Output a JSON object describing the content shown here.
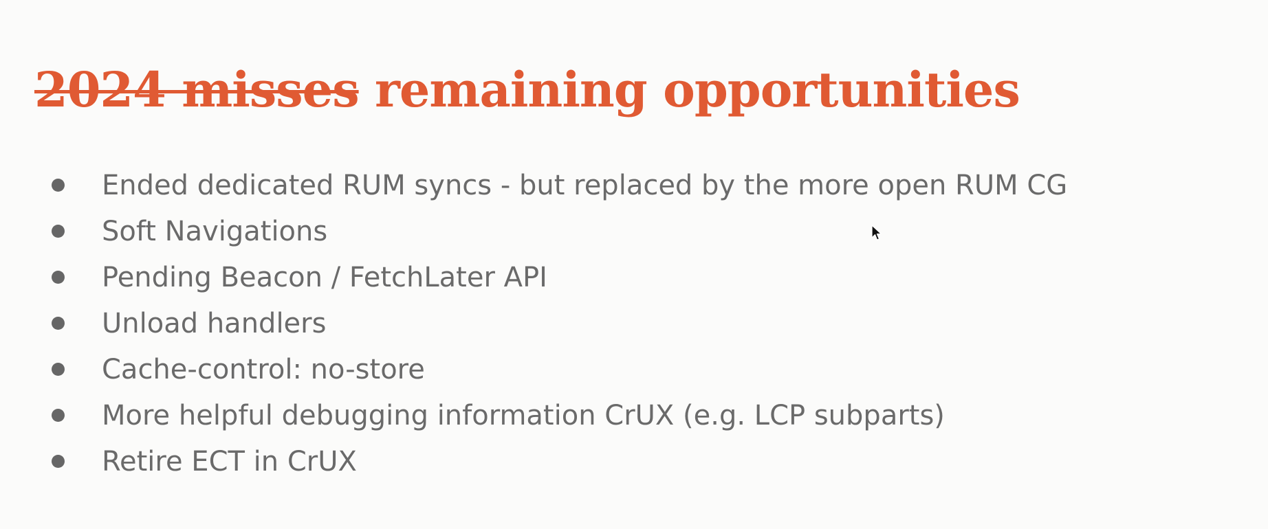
{
  "slide": {
    "title_struck": "2024 misses",
    "title_rest": "remaining opportunities",
    "bullets": [
      "Ended dedicated RUM syncs - but replaced by the more open RUM CG",
      "Soft Navigations",
      "Pending Beacon / FetchLater API",
      "Unload handlers",
      "Cache-control: no-store",
      "More helpful debugging information CrUX (e.g. LCP subparts)",
      "Retire ECT in CrUX"
    ]
  },
  "colors": {
    "title": "#e05a33",
    "bullet_text": "#6a6a6a",
    "bullet_dot": "#666666",
    "background": "#fbfbfa"
  },
  "icons": {
    "cursor": "mouse-pointer-icon"
  }
}
